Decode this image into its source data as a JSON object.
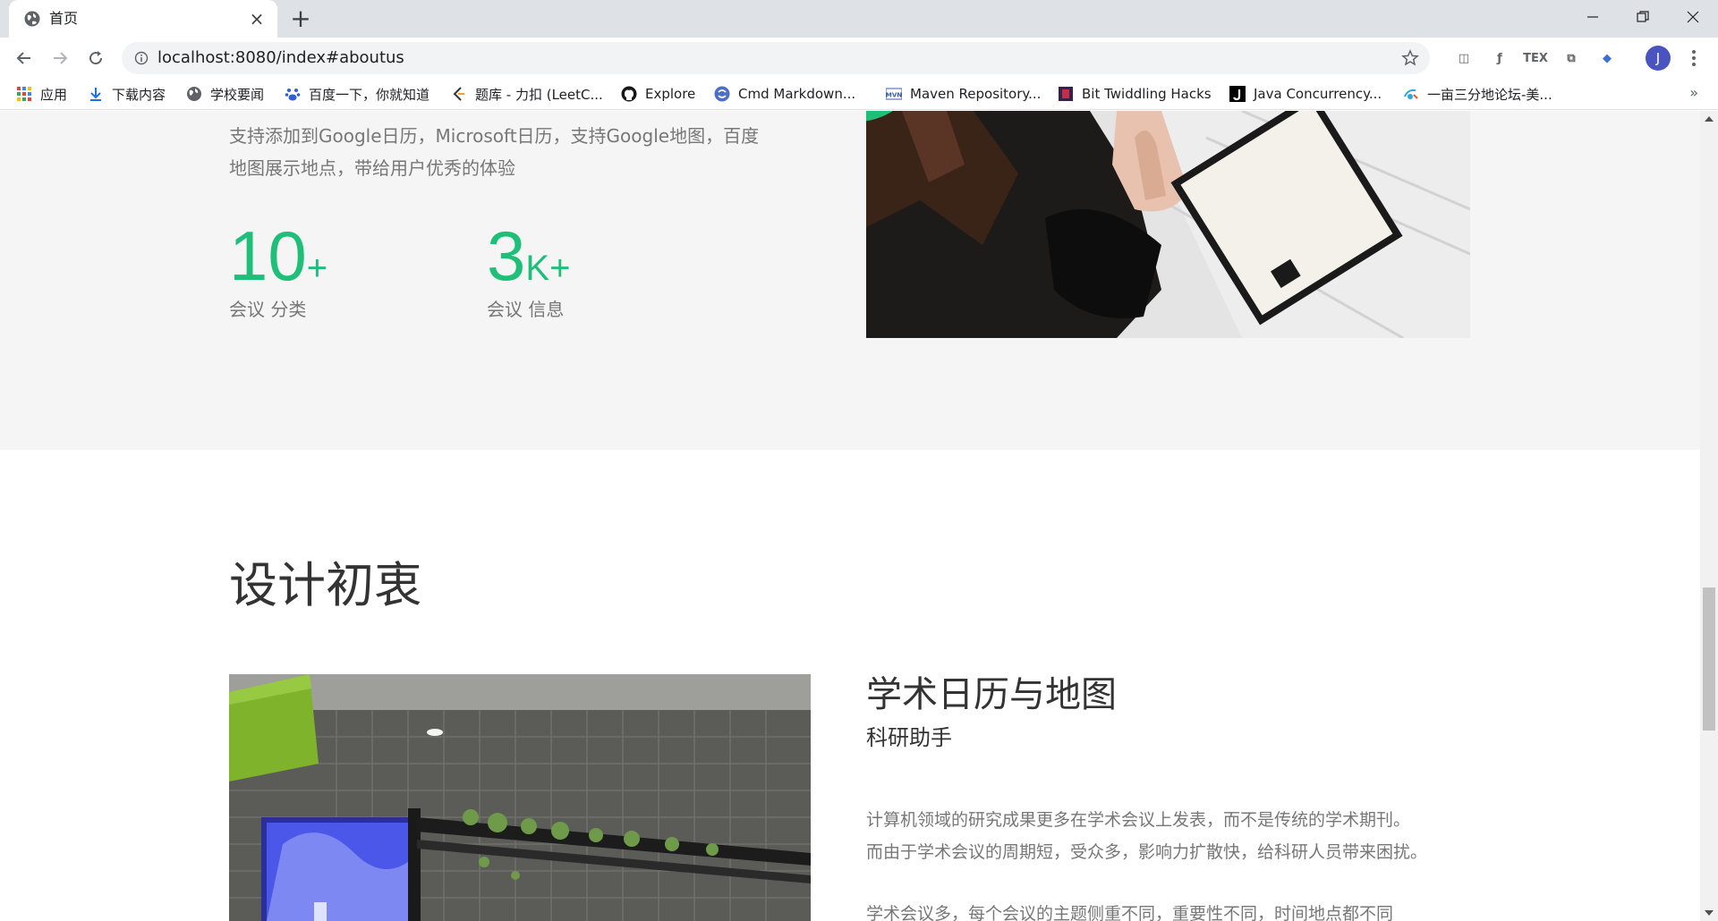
{
  "browser": {
    "tab": {
      "title": "首页",
      "favicon": "globe-icon"
    },
    "new_tab_label": "+",
    "address": {
      "url": "localhost:8080/index#aboutus"
    },
    "profile_initial": "J",
    "extensions": [
      {
        "name": "pocket-extension-icon",
        "glyph": "◫"
      },
      {
        "name": "formula-extension-icon",
        "glyph": "ƒ"
      },
      {
        "name": "tex-extension-icon",
        "glyph": "TEX"
      },
      {
        "name": "code-extension-icon",
        "glyph": "⧉"
      },
      {
        "name": "scholar-extension-icon",
        "glyph": "◆"
      }
    ],
    "bookmarks": [
      {
        "label": "应用",
        "icon": "apps-grid-icon"
      },
      {
        "label": "下载内容",
        "icon": "download-icon"
      },
      {
        "label": "学校要闻",
        "icon": "globe-icon"
      },
      {
        "label": "百度一下，你就知道",
        "icon": "baidu-paw-icon"
      },
      {
        "label": "题库 - 力扣 (LeetC...",
        "icon": "leetcode-icon"
      },
      {
        "label": "Explore",
        "icon": "github-icon"
      },
      {
        "label": "Cmd Markdown...",
        "icon": "cmd-markdown-icon"
      },
      {
        "label": "Maven Repository...",
        "icon": "maven-icon"
      },
      {
        "label": "Bit Twiddling Hacks",
        "icon": "bit-hacks-icon"
      },
      {
        "label": "Java Concurrency...",
        "icon": "java-j-icon"
      },
      {
        "label": "一亩三分地论坛-美...",
        "icon": "forum-icon"
      }
    ],
    "bookmarks_more": "»"
  },
  "page": {
    "intro": {
      "text_line1": "支持添加到Google日历，Microsoft日历，支持Google地图，百度",
      "text_line2": "地图展示地点，带给用户优秀的体验"
    },
    "stats": [
      {
        "number": "10",
        "suffix": "+",
        "label": "会议 分类"
      },
      {
        "number": "3",
        "suffix": "K+",
        "label": "会议 信息"
      }
    ],
    "design": {
      "title": "设计初衷",
      "feature_title": "学术日历与地图",
      "feature_subtitle": "科研助手",
      "p1_line1": "计算机领域的研究成果更多在学术会议上发表，而不是传统的学术期刊。",
      "p1_line2": "而由于学术会议的周期短，受众多，影响力扩散快，给科研人员带来困扰。",
      "p2_line1": "学术会议多，每个会议的主题侧重不同，重要性不同，时间地点都不同"
    }
  },
  "colors": {
    "accent_green": "#1fbf7a",
    "section_gray": "#f5f5f5",
    "body_text": "#777777",
    "heading_text": "#333333"
  }
}
